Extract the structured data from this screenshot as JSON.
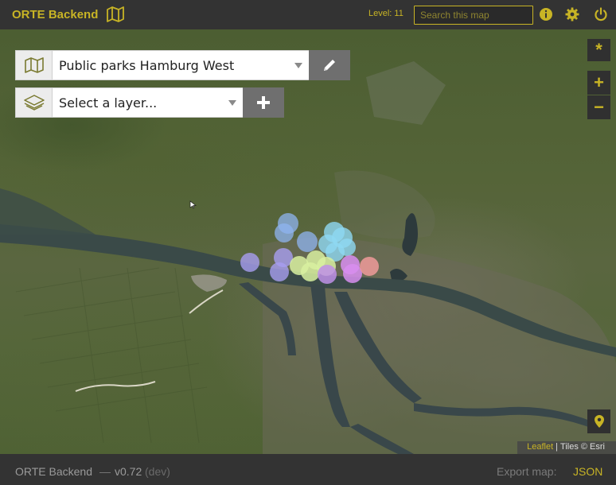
{
  "header": {
    "app_title": "ORTE Backend",
    "level_label": "Level: 11",
    "search_placeholder": "Search this map"
  },
  "map_selector": {
    "selected_map": "Public parks Hamburg West"
  },
  "layer_selector": {
    "placeholder": "Select a layer..."
  },
  "map_controls": {
    "reset_label": "*",
    "zoom_in_label": "+",
    "zoom_out_label": "−"
  },
  "attribution": {
    "leaflet": "Leaflet",
    "separator": "|",
    "tiles": "Tiles © Esri"
  },
  "footer": {
    "app_name": "ORTE Backend",
    "separator": "—",
    "version": "v0.72",
    "channel": "(dev)",
    "export_label": "Export map:",
    "export_format": "JSON"
  },
  "colors": {
    "accent": "#c8b425",
    "bar_background": "#333333",
    "marker_blue": "#8fb4f0",
    "marker_cyan": "#8ed8f2",
    "marker_violet": "#a89ef0",
    "marker_green": "#d8f0a0",
    "marker_magenta": "#d88ef0",
    "marker_red": "#f09a9a"
  },
  "icons": [
    "map-icon",
    "info-icon",
    "gear-icon",
    "power-icon",
    "layers-icon",
    "pencil-icon",
    "plus-icon",
    "location-pin-icon"
  ]
}
